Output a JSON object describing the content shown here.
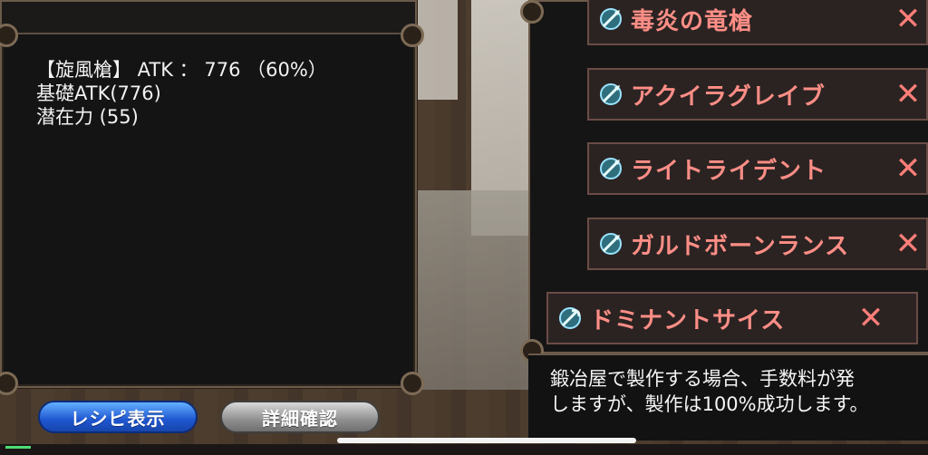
{
  "stats": {
    "line1": "【旋風槍】 ATK ： 776 （60%）",
    "line2": "基礎ATK(776)",
    "line3": "潜在力 (55)"
  },
  "weapons": [
    {
      "name": "毒炎の竜槍",
      "icon": "spear-weapon-icon",
      "remove": "✕"
    },
    {
      "name": "アクイラグレイブ",
      "icon": "spear-weapon-icon",
      "remove": "✕"
    },
    {
      "name": "ライトライデント",
      "icon": "spear-weapon-icon",
      "remove": "✕"
    },
    {
      "name": "ガルドボーンランス",
      "icon": "spear-weapon-icon",
      "remove": "✕"
    },
    {
      "name": "ドミナントサイス",
      "icon": "scythe-weapon-icon",
      "remove": "✕"
    }
  ],
  "description": {
    "line1": "鍛冶屋で製作する場合、手数料が発",
    "line2": "しますが、製作は100%成功します。"
  },
  "buttons": {
    "recipe": "レシピ表示",
    "detail": "詳細確認"
  },
  "colors": {
    "weapon_text": "#ff8e86",
    "recipe_button": "#1f57d1",
    "detail_button": "#8f8f8f"
  }
}
